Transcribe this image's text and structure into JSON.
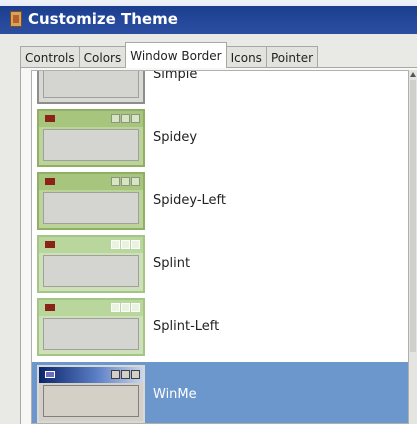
{
  "window": {
    "title": "Customize Theme"
  },
  "tabs": [
    {
      "label": "Controls"
    },
    {
      "label": "Colors"
    },
    {
      "label": "Window Border"
    },
    {
      "label": "Icons"
    },
    {
      "label": "Pointer"
    }
  ],
  "selected_tab": "Window Border",
  "themes": [
    {
      "name": "Simple",
      "selected": false
    },
    {
      "name": "Spidey",
      "selected": false
    },
    {
      "name": "Spidey-Left",
      "selected": false
    },
    {
      "name": "Splint",
      "selected": false
    },
    {
      "name": "Splint-Left",
      "selected": false
    },
    {
      "name": "WinMe",
      "selected": true
    }
  ],
  "colors": {
    "title_bar": "#24479a",
    "selection": "#6b97cd",
    "spidey_border": "#a8c57e",
    "splint_border": "#b9d79c"
  }
}
